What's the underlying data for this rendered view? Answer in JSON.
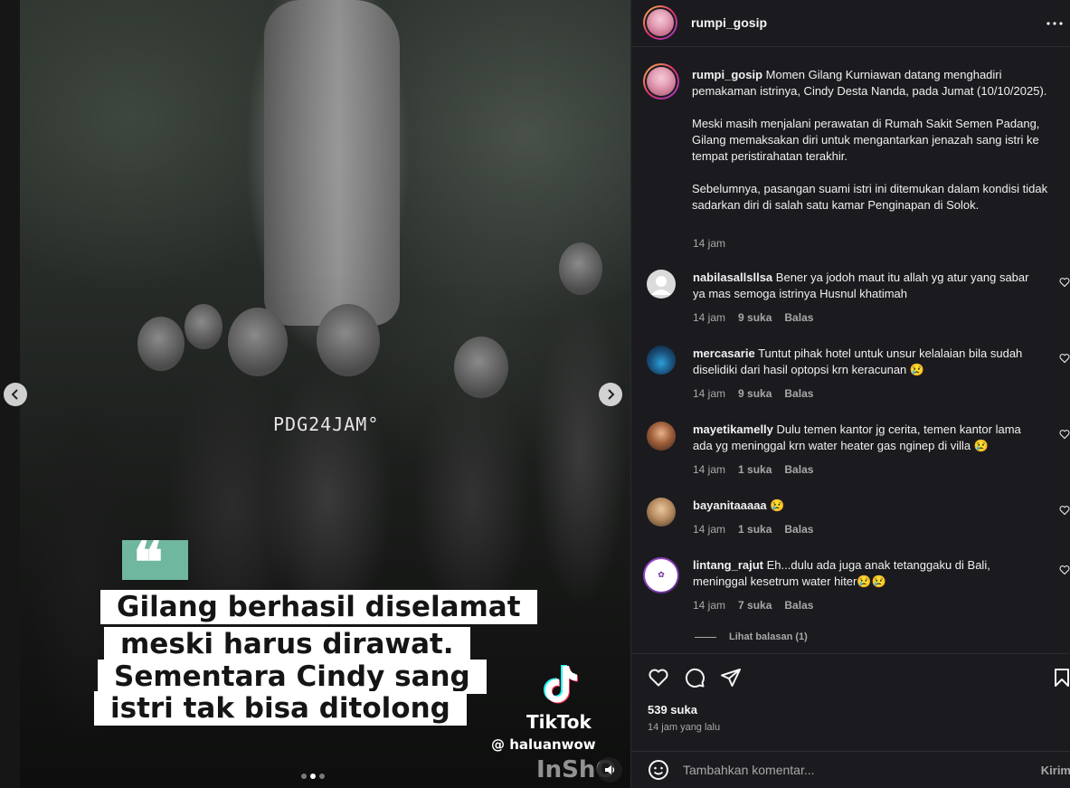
{
  "media": {
    "watermark": "PDG24JAM°",
    "quote_mark": "❝",
    "caption_lines": [
      "Gilang berhasil diselamat",
      "meski harus dirawat.",
      "Sementara Cindy sang",
      "istri tak bisa ditolong"
    ],
    "tiktok_name": "TikTok",
    "tiktok_handle": "@ haluanwow",
    "inshot": "InShO",
    "carousel": {
      "count": 3,
      "active": 1
    }
  },
  "header": {
    "username": "rumpi_gosip"
  },
  "caption": {
    "username": "rumpi_gosip",
    "paragraphs": [
      "Momen Gilang Kurniawan datang menghadiri pemakaman istrinya, Cindy Desta Nanda, pada Jumat (10/10/2025).",
      "Meski masih menjalani perawatan di Rumah Sakit Semen Padang, Gilang memaksakan diri untuk mengantarkan jenazah sang istri ke tempat peristirahatan terakhir.",
      "Sebelumnya, pasangan suami istri ini ditemukan dalam kondisi tidak sadarkan diri di salah satu kamar Penginapan di Solok."
    ],
    "time": "14 jam"
  },
  "comments": [
    {
      "username": "nabilasallsllsa",
      "text": "Bener ya jodoh maut itu allah yg atur yang sabar ya mas semoga istrinya Husnul khatimah",
      "time": "14 jam",
      "likes": "9 suka",
      "reply": "Balas"
    },
    {
      "username": "mercasarie",
      "text": "Tuntut pihak hotel untuk unsur kelalaian bila sudah diselidiki dari hasil optopsi krn keracunan 😢",
      "time": "14 jam",
      "likes": "9 suka",
      "reply": "Balas"
    },
    {
      "username": "mayetikamelly",
      "text": "Dulu temen kantor jg cerita, temen kantor lama ada yg meninggal krn water heater gas nginep di villa 😢",
      "time": "14 jam",
      "likes": "1 suka",
      "reply": "Balas"
    },
    {
      "username": "bayanitaaaaa",
      "text": "😢",
      "time": "14 jam",
      "likes": "1 suka",
      "reply": "Balas"
    },
    {
      "username": "lintang_rajut",
      "text": "Eh...dulu ada juga anak tetanggaku di Bali, meninggal kesetrum water hiter😢😢",
      "time": "14 jam",
      "likes": "7 suka",
      "reply": "Balas"
    }
  ],
  "view_replies": "Lihat balasan (1)",
  "stats": {
    "likes": "539 suka",
    "time": "14 jam yang lalu"
  },
  "comment_box": {
    "placeholder": "Tambahkan komentar...",
    "send": "Kirim"
  },
  "colors": {
    "panel_bg": "#1b1b1f",
    "muted_text": "#a8a8a8",
    "caption_highlight": "#6fb79f"
  }
}
